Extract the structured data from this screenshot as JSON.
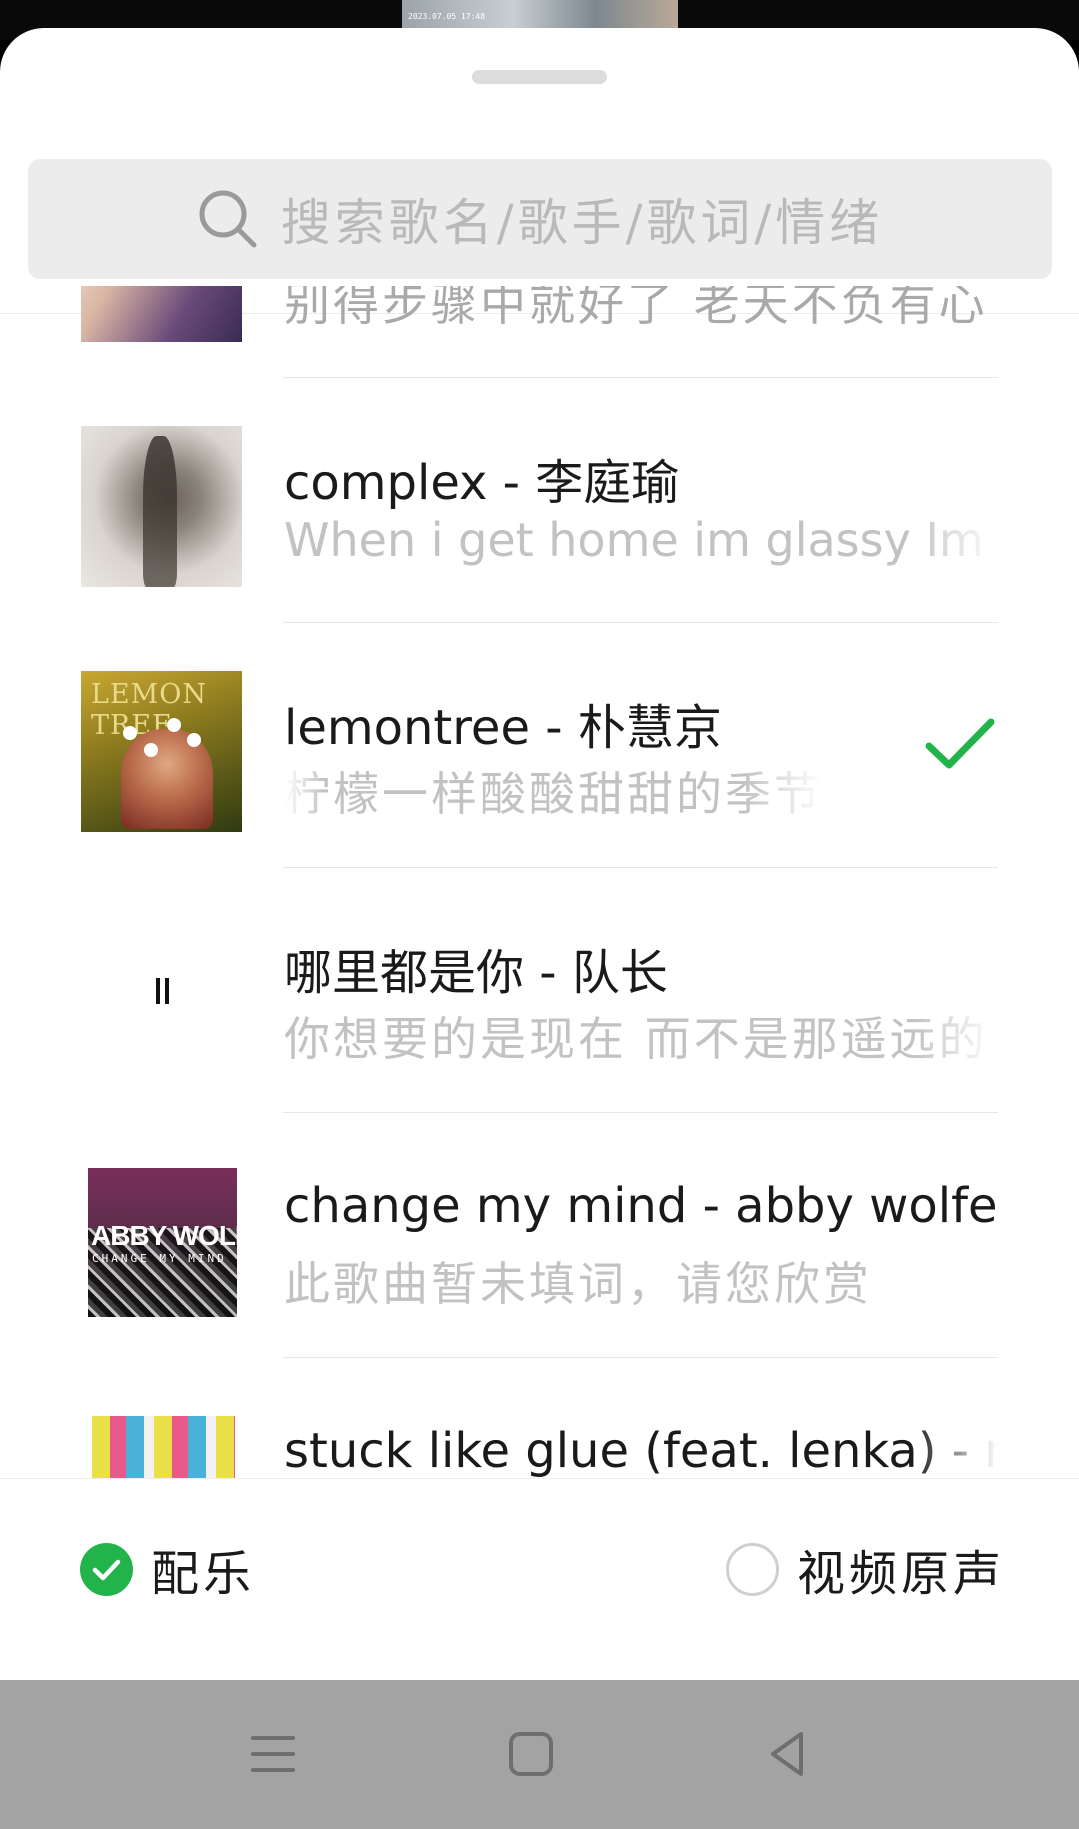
{
  "background": {
    "thumbnail_timestamp": "2023.07.05 17:48"
  },
  "search": {
    "placeholder": "搜索歌名/歌手/歌词/情绪",
    "icon": "search-icon"
  },
  "songs": [
    {
      "title": "",
      "subtitle": "别得步骤中就好了 老天不负有心",
      "cover": "album-cover",
      "selected": false,
      "playing": false
    },
    {
      "title_en": "complex - ",
      "title_cn": "李庭瑜",
      "subtitle": "When i get home im glassy  Im in",
      "cover": "album-cover",
      "selected": false,
      "playing": false
    },
    {
      "title_en": "lemontree - ",
      "title_cn": "朴慧京",
      "subtitle": "柠檬一样酸酸甜甜的季节",
      "cover": "album-cover",
      "cover_text": "LEMON TREE",
      "selected": true,
      "playing": false
    },
    {
      "title_en": "",
      "title_cn": "哪里都是你 - 队长",
      "subtitle": "你想要的是现在  而不是那遥远的",
      "cover": "none",
      "selected": false,
      "playing": true
    },
    {
      "title_en": "change my mind - abby wolfe",
      "title_cn": "",
      "subtitle": "此歌曲暂未填词，请您欣赏",
      "cover": "album-cover",
      "cover_text": "ABBY WOLFE",
      "cover_subtext": "CHANGE MY MIND",
      "selected": false,
      "playing": false
    },
    {
      "title_en": "stuck like glue (feat. lenka) - nick",
      "title_cn": "",
      "subtitle": "",
      "cover": "album-cover",
      "selected": false,
      "playing": false
    }
  ],
  "options": {
    "music": {
      "label": "配乐",
      "checked": true
    },
    "original": {
      "label": "视频原声",
      "checked": false
    }
  },
  "colors": {
    "accent": "#22b44a",
    "navbar": "#a3a3a3"
  },
  "navbar": {
    "buttons": [
      "menu-icon",
      "home-square-icon",
      "back-triangle-icon"
    ]
  }
}
